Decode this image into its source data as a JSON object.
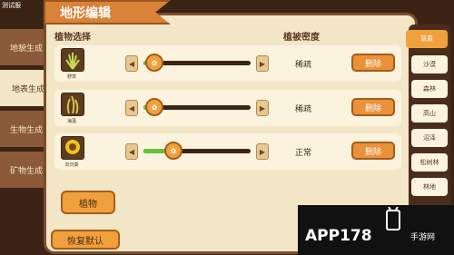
{
  "build_tag": "测试服",
  "tabs": [
    "地貌生成",
    "地表生成",
    "生物生成",
    "矿物生成"
  ],
  "title": "地形编辑",
  "headers": {
    "plant_select": "植物选择",
    "density": "植被密度"
  },
  "rows": [
    {
      "name": "野草",
      "density": "稀疏",
      "delete": "删除",
      "level": 0.05
    },
    {
      "name": "海藻",
      "density": "稀疏",
      "delete": "删除",
      "level": 0.05
    },
    {
      "name": "向日葵",
      "density": "正常",
      "delete": "删除",
      "level": 0.25
    }
  ],
  "plant_button": "植物",
  "reset_button": "恢复默认",
  "biomes": [
    "草原",
    "沙漠",
    "森林",
    "高山",
    "沼泽",
    "松树林",
    "林地"
  ],
  "watermark": {
    "text": "APP178",
    "sub": "手游网"
  }
}
